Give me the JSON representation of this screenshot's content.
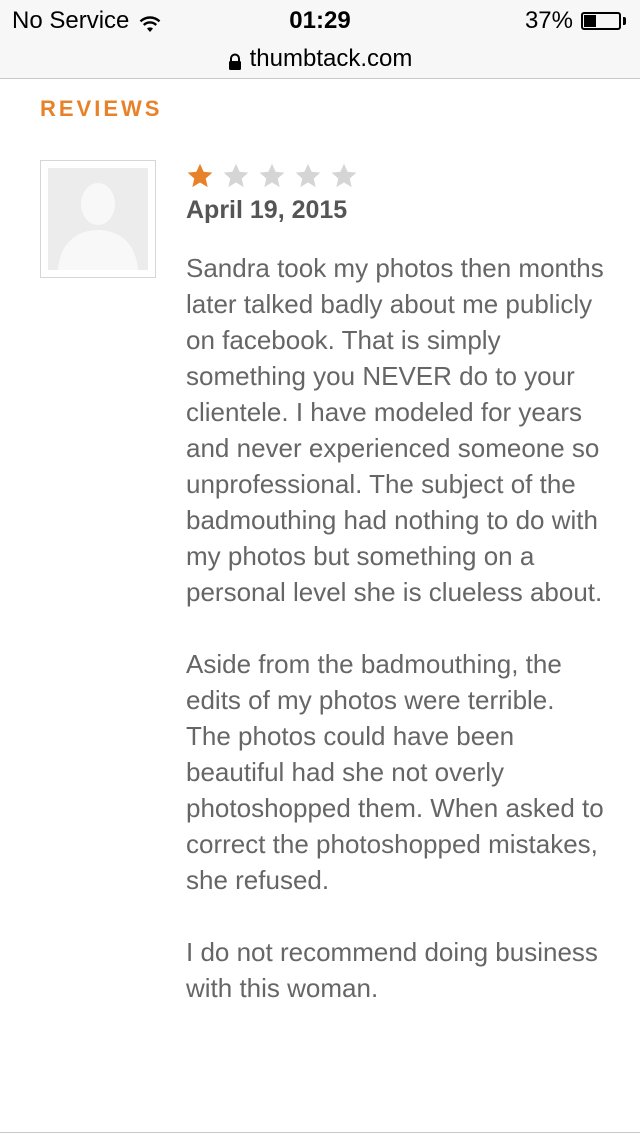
{
  "status_bar": {
    "carrier": "No Service",
    "time": "01:29",
    "battery_percent": "37%",
    "battery_level": 0.37,
    "wifi_icon": "wifi-icon",
    "battery_icon": "battery-icon"
  },
  "url_bar": {
    "domain": "thumbtack.com",
    "lock_icon": "lock-icon"
  },
  "reviews": {
    "heading": "REVIEWS",
    "accent_color": "#e8822a",
    "items": [
      {
        "avatar_icon": "default-avatar-icon",
        "rating": 1,
        "max_rating": 5,
        "date": "April 19, 2015",
        "paragraphs": [
          "Sandra took my photos then months later talked badly about me publicly on facebook. That is simply something you NEVER do to your clientele. I have modeled for years and never experienced someone so unprofessional. The subject of the badmouthing had nothing to do with my photos but something on a personal level she is clueless about.",
          "Aside from the badmouthing, the edits of my photos were terrible. The photos could have been beautiful had she not overly photoshopped them. When asked to correct the photoshopped mistakes, she refused.",
          "I do not recommend doing business with this woman."
        ]
      }
    ]
  }
}
